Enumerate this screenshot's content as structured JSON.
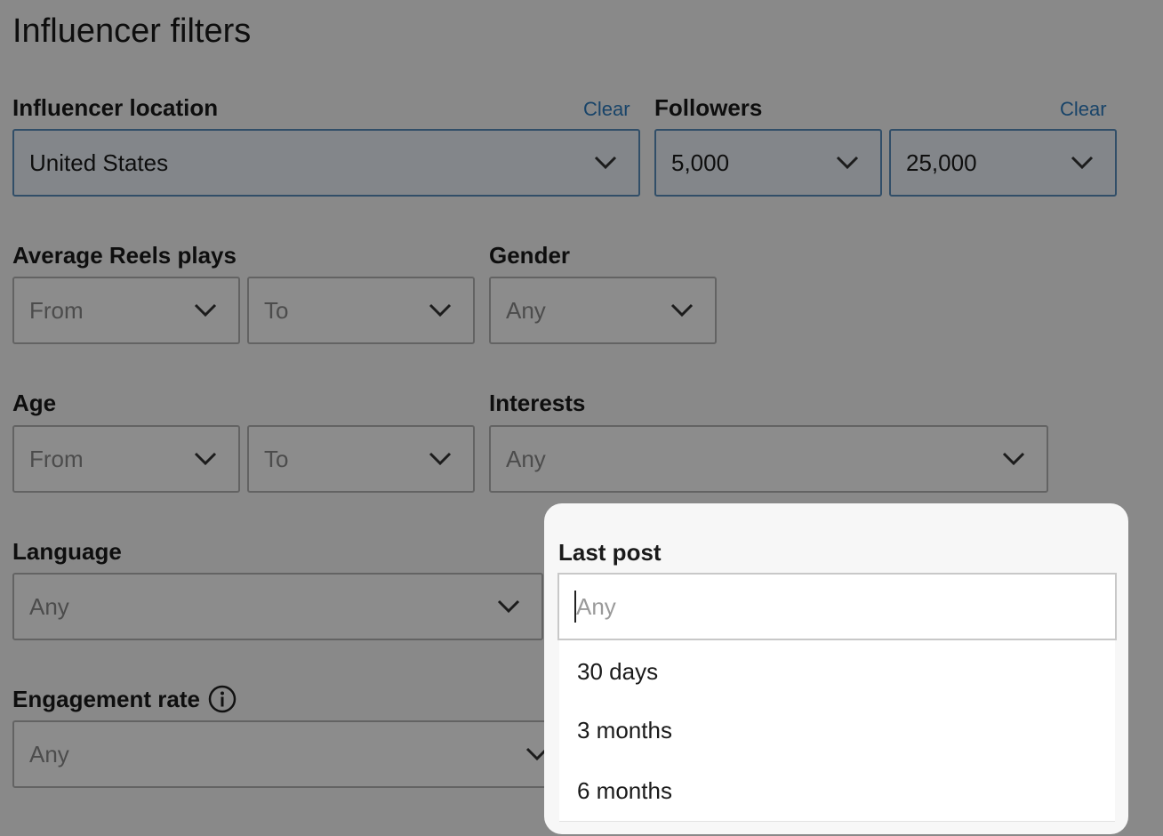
{
  "page": {
    "title": "Influencer filters"
  },
  "location": {
    "label": "Influencer location",
    "clear": "Clear",
    "value": "United States"
  },
  "followers": {
    "label": "Followers",
    "clear": "Clear",
    "from": "5,000",
    "to": "25,000"
  },
  "reels": {
    "label": "Average Reels plays",
    "from": "From",
    "to": "To"
  },
  "gender": {
    "label": "Gender",
    "value": "Any"
  },
  "age": {
    "label": "Age",
    "from": "From",
    "to": "To"
  },
  "interests": {
    "label": "Interests",
    "value": "Any"
  },
  "language": {
    "label": "Language",
    "value": "Any"
  },
  "engagement": {
    "label": "Engagement rate",
    "value": "Any",
    "icon": "info-icon"
  },
  "last_post": {
    "label": "Last post",
    "placeholder": "Any",
    "options": [
      "30 days",
      "3 months",
      "6 months"
    ]
  },
  "colors": {
    "accent": "#2e7dbf",
    "overlay": "rgba(0,0,0,0.45)"
  }
}
